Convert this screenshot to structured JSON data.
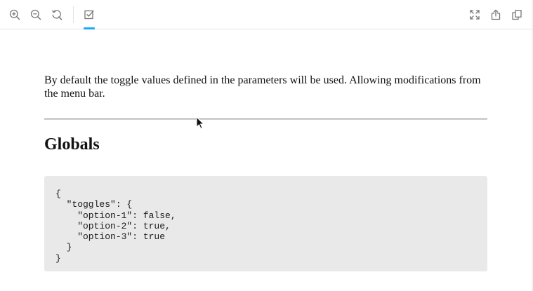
{
  "toolbar": {
    "buttons_left": [
      {
        "icon": "zoom-in-icon"
      },
      {
        "icon": "zoom-out-icon"
      },
      {
        "icon": "reset-zoom-icon"
      },
      {
        "icon": "toggles-addon-icon",
        "active": true
      }
    ],
    "buttons_right": [
      {
        "icon": "fullscreen-icon"
      },
      {
        "icon": "share-icon"
      },
      {
        "icon": "copy-link-icon"
      }
    ],
    "accent_color": "#1ea7fd"
  },
  "doc": {
    "intro": "By default the toggle values defined in the parameters will be used. Allowing modifications from the menu bar.",
    "heading": "Globals",
    "code_lines": [
      "{",
      "  \"toggles\": {",
      "    \"option-1\": false,",
      "    \"option-2\": true,",
      "    \"option-3\": true",
      "  }",
      "}"
    ]
  }
}
